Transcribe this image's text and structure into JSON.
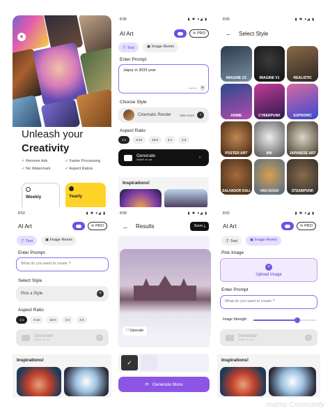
{
  "panel1": {
    "headline1": "Unleash your",
    "headline2": "Creativity",
    "features": [
      "Remove Ads",
      "Faster Processing",
      "No Watermark",
      "Aspect Ratios"
    ],
    "plans": [
      "Weekly",
      "Yearly"
    ]
  },
  "panel2": {
    "time": "8:36",
    "title": "AI Art",
    "pro": "PRO",
    "tabs": [
      "Text",
      "Image Remix"
    ],
    "prompt_label": "Enter Prompt",
    "prompt_value": "Jaipur in 3033 year",
    "char_count": "19/500",
    "style_label": "Choose Style",
    "style_value": "Cinematic Render",
    "view_more": "View more",
    "aspect_label": "Aspect Ratio",
    "ratios": [
      "1:1",
      "9:16",
      "16:9",
      "3:4",
      "4:3"
    ],
    "generate": "Generate",
    "generate_sub": "Watch an ad",
    "inspirations": "Inspirations!"
  },
  "panel3": {
    "time": "8:55",
    "title": "Select Style",
    "styles": [
      "IMAGINE V2",
      "IMAGINE V1",
      "REALISTIC",
      "ANIME",
      "CYBERPUNK",
      "EUPHORIC",
      "POSTER ART",
      "INK",
      "JAPANESE ART",
      "SALVADOR DALI",
      "VAN GOGH",
      "STEAMPUNK"
    ]
  },
  "panel4": {
    "time": "8:52",
    "title": "AI Art",
    "pro": "PRO",
    "tabs": [
      "Text",
      "Image Remix"
    ],
    "prompt_label": "Enter Prompt",
    "prompt_placeholder": "What do you want to create ?",
    "style_label": "Select Style",
    "style_value": "Pick a Style",
    "aspect_label": "Aspect Ratio",
    "ratios": [
      "1:1",
      "9:16",
      "16:9",
      "3:4",
      "4:3"
    ],
    "generate": "Generate",
    "generate_sub": "Watch an ad",
    "inspirations": "Inspirations!"
  },
  "panel5": {
    "time": "8:58",
    "title": "Results",
    "save": "Save",
    "upscale": "Upscale",
    "generate_more": "Generate More"
  },
  "panel6": {
    "time": "8:52",
    "title": "AI Art",
    "pro": "PRO",
    "tabs": [
      "Text",
      "Image Remix"
    ],
    "pick_label": "Pick Image",
    "upload": "Upload Image",
    "prompt_label": "Enter Prompt",
    "prompt_placeholder": "What do you want to create ?",
    "strength_label": "Image Strength",
    "strength_value": 0.7,
    "generate": "Generate",
    "generate_sub": "Watch an ad",
    "inspirations": "Inspirations!"
  },
  "watermark": "realme Community",
  "colors": {
    "accent": "#6a52e8",
    "yellow": "#ffd428",
    "purple_btn": "#8c55e6"
  }
}
